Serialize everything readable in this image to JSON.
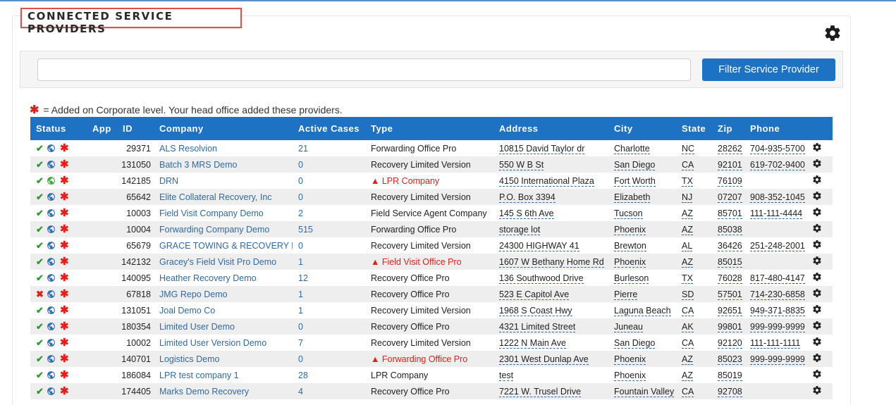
{
  "page": {
    "section_title": "CONNECTED SERVICE PROVIDERS",
    "filter_placeholder": "",
    "filter_button_label": "Filter Service Provider",
    "note_text": "= Added on Corporate level. Your head office added these providers."
  },
  "table": {
    "headers": {
      "status": "Status",
      "app": "App",
      "id": "ID",
      "company": "Company",
      "active_cases": "Active Cases",
      "type": "Type",
      "address": "Address",
      "city": "City",
      "state": "State",
      "zip": "Zip",
      "phone": "Phone"
    },
    "rows": [
      {
        "status": "check",
        "globe": "blue",
        "id": "29371",
        "company": "ALS Resolvion",
        "cases": "21",
        "type": "Forwarding Office Pro",
        "type_warning": false,
        "address": "10815 David Taylor dr",
        "city": "Charlotte",
        "state": "NC",
        "zip": "28262",
        "phone": "704-935-5700"
      },
      {
        "status": "check",
        "globe": "blue",
        "id": "131050",
        "company": "Batch 3 MRS Demo",
        "cases": "0",
        "type": "Recovery Limited Version",
        "type_warning": false,
        "address": "550 W B St",
        "city": "San Diego",
        "state": "CA",
        "zip": "92101",
        "phone": "619-702-9400"
      },
      {
        "status": "check",
        "globe": "green",
        "id": "142185",
        "company": "DRN",
        "cases": "0",
        "type": "LPR Company",
        "type_warning": true,
        "address": "4150 International Plaza",
        "city": "Fort Worth",
        "state": "TX",
        "zip": "76109",
        "phone": ""
      },
      {
        "status": "check",
        "globe": "blue",
        "id": "65642",
        "company": "Elite Collateral Recovery, Inc",
        "cases": "0",
        "type": "Recovery Limited Version",
        "type_warning": false,
        "address": "P.O. Box 3394",
        "city": "Elizabeth",
        "state": "NJ",
        "zip": "07207",
        "phone": "908-352-1045"
      },
      {
        "status": "check",
        "globe": "blue",
        "id": "10003",
        "company": "Field Visit Company Demo",
        "cases": "2",
        "type": "Field Service Agent Company",
        "type_warning": false,
        "address": "145 S 6th Ave",
        "city": "Tucson",
        "state": "AZ",
        "zip": "85701",
        "phone": "111-111-4444"
      },
      {
        "status": "check",
        "globe": "blue",
        "id": "10004",
        "company": "Forwarding Company Demo",
        "cases": "515",
        "type": "Forwarding Office Pro",
        "type_warning": false,
        "address": "storage lot",
        "city": "Phoenix",
        "state": "AZ",
        "zip": "85038",
        "phone": ""
      },
      {
        "status": "check",
        "globe": "blue",
        "id": "65679",
        "company": "GRACE TOWING & RECOVERY LLC",
        "cases": "0",
        "type": "Recovery Limited Version",
        "type_warning": false,
        "address": "24300 HIGHWAY 41",
        "city": "Brewton",
        "state": "AL",
        "zip": "36426",
        "phone": "251-248-2001"
      },
      {
        "status": "check",
        "globe": "blue",
        "id": "142132",
        "company": "Gracey's Field Visit Pro Demo",
        "cases": "1",
        "type": "Field Visit Office Pro",
        "type_warning": true,
        "address": "1607 W Bethany Home Rd",
        "city": "Phoenix",
        "state": "AZ",
        "zip": "85015",
        "phone": ""
      },
      {
        "status": "check",
        "globe": "blue",
        "id": "140095",
        "company": "Heather Recovery Demo",
        "cases": "12",
        "type": "Recovery Office Pro",
        "type_warning": false,
        "address": "136 Southwood Drive",
        "city": "Burleson",
        "state": "TX",
        "zip": "76028",
        "phone": "817-480-4147"
      },
      {
        "status": "x",
        "globe": "blue",
        "id": "67818",
        "company": "JMG Repo Demo",
        "cases": "1",
        "type": "Recovery Office Pro",
        "type_warning": false,
        "address": "523 E Capitol Ave",
        "city": "Pierre",
        "state": "SD",
        "zip": "57501",
        "phone": "714-230-6858"
      },
      {
        "status": "check",
        "globe": "blue",
        "id": "131051",
        "company": "Joal Demo Co",
        "cases": "1",
        "type": "Recovery Limited Version",
        "type_warning": false,
        "address": "1968 S Coast Hwy",
        "city": "Laguna Beach",
        "state": "CA",
        "zip": "92651",
        "phone": "949-371-8835"
      },
      {
        "status": "check",
        "globe": "blue",
        "id": "180354",
        "company": "Limited User Demo",
        "cases": "0",
        "type": "Recovery Office Pro",
        "type_warning": false,
        "address": "4321 Limited Street",
        "city": "Juneau",
        "state": "AK",
        "zip": "99801",
        "phone": "999-999-9999"
      },
      {
        "status": "check",
        "globe": "blue",
        "id": "10002",
        "company": "Limited User Version Demo",
        "cases": "7",
        "type": "Recovery Limited Version",
        "type_warning": false,
        "address": "1222 N Main Ave",
        "city": "San Diego",
        "state": "CA",
        "zip": "92120",
        "phone": "111-111-1111"
      },
      {
        "status": "check",
        "globe": "blue",
        "id": "140701",
        "company": "Logistics Demo",
        "cases": "0",
        "type": "Forwarding Office Pro",
        "type_warning": true,
        "address": "2301 West Dunlap Ave",
        "city": "Phoenix",
        "state": "AZ",
        "zip": "85023",
        "phone": "999-999-9999"
      },
      {
        "status": "check",
        "globe": "blue",
        "id": "186084",
        "company": "LPR test company 1",
        "cases": "28",
        "type": "LPR Company",
        "type_warning": false,
        "address": "test",
        "city": "Phoenix",
        "state": "AZ",
        "zip": "85019",
        "phone": ""
      },
      {
        "status": "check",
        "globe": "blue",
        "id": "174405",
        "company": "Marks Demo Recovery",
        "cases": "4",
        "type": "Recovery Office Pro",
        "type_warning": false,
        "address": "7221 W. Trusel Drive",
        "city": "Fountain Valley",
        "state": "CA",
        "zip": "92708",
        "phone": ""
      }
    ]
  },
  "colors": {
    "header_blue": "#1d72c3",
    "link_blue": "#2f6aa3",
    "warning_red": "#e0201b",
    "check_green": "#2e9a2e"
  }
}
